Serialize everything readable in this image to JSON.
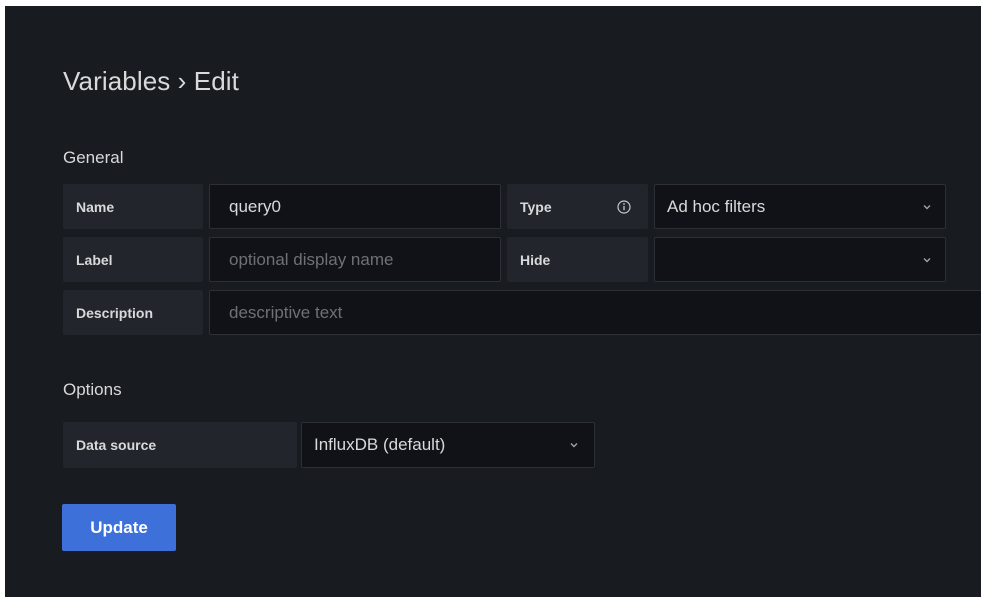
{
  "page": {
    "title": "Variables › Edit"
  },
  "general": {
    "heading": "General",
    "name": {
      "label": "Name",
      "value": "query0"
    },
    "type": {
      "label": "Type",
      "value": "Ad hoc filters",
      "info_icon": "info-circle-icon"
    },
    "label": {
      "label": "Label",
      "placeholder": "optional display name"
    },
    "hide": {
      "label": "Hide",
      "value": ""
    },
    "description": {
      "label": "Description",
      "placeholder": "descriptive text"
    }
  },
  "options": {
    "heading": "Options",
    "data_source": {
      "label": "Data source",
      "value": "InfluxDB (default)"
    }
  },
  "actions": {
    "update_label": "Update"
  },
  "colors": {
    "background": "#181b1f",
    "label_bg": "#22252b",
    "input_bg": "#111217",
    "primary": "#3d71d9",
    "text": "#d8d9da",
    "placeholder": "#6e7077"
  }
}
